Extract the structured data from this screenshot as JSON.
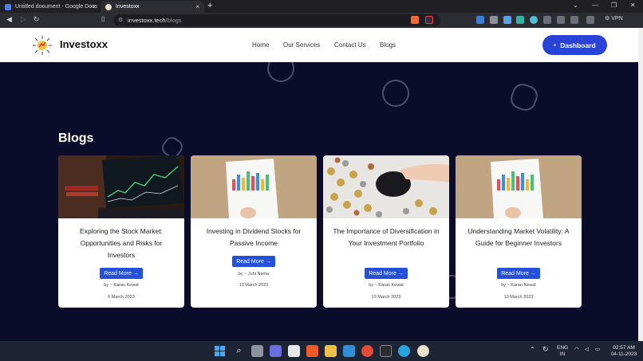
{
  "browser": {
    "tabs": [
      {
        "title": "Untitled document - Google Docs",
        "active": false
      },
      {
        "title": "Investoxx",
        "active": true
      }
    ],
    "new_tab": "+",
    "close_glyph": "×",
    "url_host": "investoxx.tech",
    "url_path": "/blogs",
    "vpn_label": "VPN",
    "window_controls": [
      "⌄",
      "—",
      "❐",
      "✕"
    ]
  },
  "site": {
    "brand": "Investoxx",
    "nav": [
      "Home",
      "Our Services",
      "Contact Us",
      "Blogs"
    ],
    "dashboard_label": "Dashboard",
    "page_title": "Blogs",
    "read_more_label": "Read More →"
  },
  "posts": [
    {
      "title": "Exploring the Stock Market: Opportunities and Risks for Investors",
      "author": "by ~ Karan Kewat",
      "date": "6 March 2023",
      "image": "laptop-stock-chart"
    },
    {
      "title": "Investing in Dividend Stocks for Passive Income",
      "author": "by ~ Juhi Nema",
      "date": "13 March 2023",
      "image": "paper-bar-chart"
    },
    {
      "title": "The Importance of Diversification in Your Investment Portfolio",
      "author": "by ~ Karan Kewat",
      "date": "13 March 2023",
      "image": "coins-piggy-bank"
    },
    {
      "title": "Understanding Market Volatility: A Guide for Beginner Investors",
      "author": "by ~ Karan Kewat",
      "date": "13 March 2023",
      "image": "paper-bar-chart"
    }
  ],
  "taskbar": {
    "language": "ENG",
    "region": "IN",
    "time": "02:57 AM",
    "date": "04-11-2023",
    "apps": [
      "windows-start-icon",
      "search-icon",
      "file-explorer-icon",
      "teams-icon",
      "store-icon",
      "brave-icon",
      "folder-icon",
      "vscode-icon",
      "chrome-icon",
      "terminal-icon",
      "telegram-icon",
      "investoxx-icon"
    ]
  },
  "colors": {
    "page_bg": "#0b0c2a",
    "accent": "#2943d8",
    "button": "#2451d8"
  }
}
